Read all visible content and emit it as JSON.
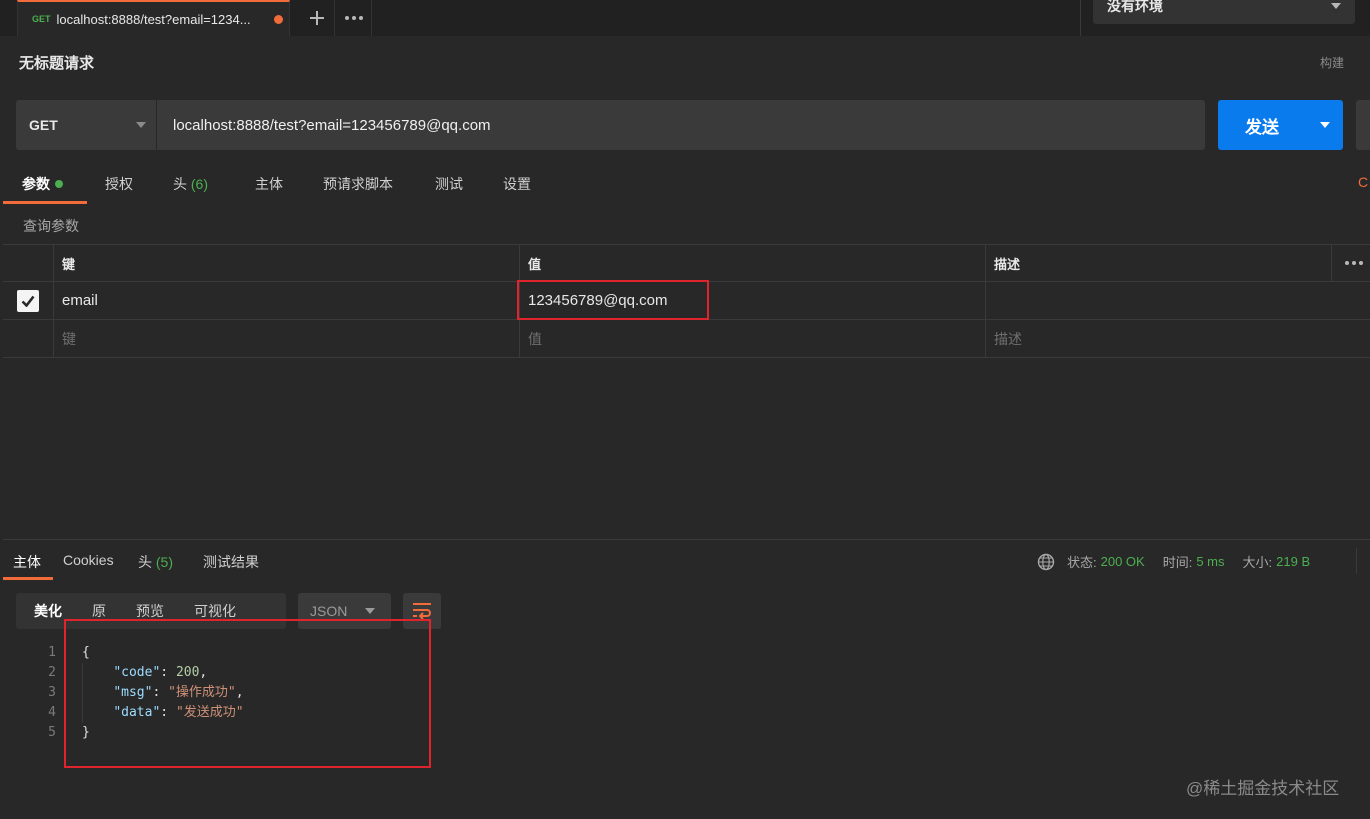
{
  "tabbar": {
    "active_tab": {
      "method": "GET",
      "title": "localhost:8888/test?email=1234..."
    },
    "environment": "没有环境"
  },
  "request": {
    "title": "无标题请求",
    "build_label": "构建",
    "method": "GET",
    "url": "localhost:8888/test?email=123456789@qq.com",
    "send_label": "发送"
  },
  "request_tabs": [
    {
      "label": "参数",
      "count": ""
    },
    {
      "label": "授权",
      "count": ""
    },
    {
      "label": "头",
      "count": "(6)"
    },
    {
      "label": "主体",
      "count": ""
    },
    {
      "label": "预请求脚本",
      "count": ""
    },
    {
      "label": "测试",
      "count": ""
    },
    {
      "label": "设置",
      "count": ""
    }
  ],
  "cookies_stub": "C",
  "query_params": {
    "section_label": "查询参数",
    "headers": {
      "key": "键",
      "value": "值",
      "description": "描述"
    },
    "rows": [
      {
        "checked": true,
        "key": "email",
        "value": "123456789@qq.com",
        "description": ""
      }
    ],
    "placeholders": {
      "key": "键",
      "value": "值",
      "description": "描述"
    }
  },
  "response": {
    "tabs": [
      {
        "label": "主体",
        "count": ""
      },
      {
        "label": "Cookies",
        "count": ""
      },
      {
        "label": "头",
        "count": "(5)"
      },
      {
        "label": "测试结果",
        "count": ""
      }
    ],
    "status": {
      "status_label": "状态:",
      "status_value": "200 OK",
      "time_label": "时间:",
      "time_value": "5 ms",
      "size_label": "大小:",
      "size_value": "219 B"
    },
    "format_modes": [
      "美化",
      "原",
      "预览",
      "可视化"
    ],
    "format_type": "JSON",
    "body_lines": [
      {
        "n": "1",
        "indent": "",
        "key": "",
        "val": "",
        "raw": "{"
      },
      {
        "n": "2",
        "indent": "    ",
        "key": "\"code\"",
        "val": "200",
        "sep": ": ",
        "tail": ","
      },
      {
        "n": "3",
        "indent": "    ",
        "key": "\"msg\"",
        "val": "\"操作成功\"",
        "sep": ": ",
        "tail": ","
      },
      {
        "n": "4",
        "indent": "    ",
        "key": "\"data\"",
        "val": "\"发送成功\"",
        "sep": ": ",
        "tail": ""
      },
      {
        "n": "5",
        "indent": "",
        "key": "",
        "val": "",
        "raw": "}"
      }
    ]
  },
  "watermark": "@稀土掘金技术社区",
  "colors": {
    "accent": "#f26b3a",
    "primary": "#097bed",
    "success": "#4caf50",
    "highlight": "#e0242e"
  }
}
